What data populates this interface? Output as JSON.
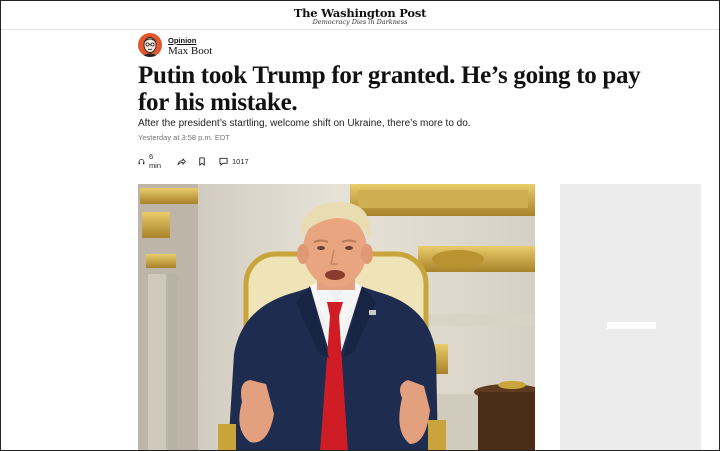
{
  "masthead": {
    "logo": "The Washington Post",
    "tagline": "Democracy Dies in Darkness"
  },
  "article": {
    "section": "Opinion",
    "author": "Max Boot",
    "headline": "Putin took Trump for granted. He’s going to pay for his mistake.",
    "dek": "After the president’s startling, welcome shift on Ukraine, there’s more to do.",
    "timestamp": "Yesterday at 3:58 p.m. EDT"
  },
  "toolbar": {
    "listen_label": "6 min",
    "comments_count": "1017",
    "icons": [
      "headphones-icon",
      "share-icon",
      "bookmark-icon",
      "comment-icon"
    ]
  },
  "colors": {
    "avatar_bg": "#e4572e",
    "tie": "#d01c24",
    "suit": "#1e2c4f",
    "gold": "#c9a43a",
    "ad_bg": "#ececec"
  }
}
